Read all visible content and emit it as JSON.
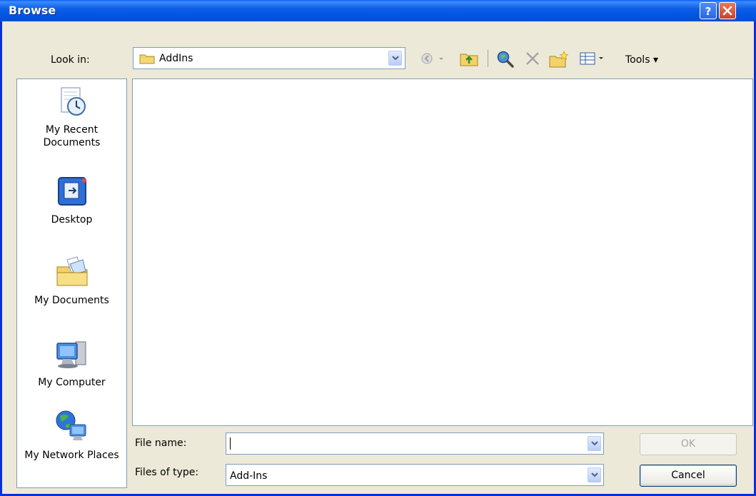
{
  "window": {
    "title": "Browse",
    "help_glyph": "?",
    "close_glyph": "✕"
  },
  "lookin": {
    "label": "Look in:",
    "value": "AddIns"
  },
  "toolbar": {
    "icons": [
      "back-icon",
      "up-folder-icon",
      "search-web-icon",
      "delete-icon",
      "new-folder-icon",
      "views-icon"
    ],
    "tools_label": "Tools ▾"
  },
  "places": [
    {
      "label": "My Recent Documents",
      "icon": "recent-documents-icon"
    },
    {
      "label": "Desktop",
      "icon": "desktop-icon"
    },
    {
      "label": "My Documents",
      "icon": "my-documents-icon"
    },
    {
      "label": "My Computer",
      "icon": "my-computer-icon"
    },
    {
      "label": "My Network Places",
      "icon": "network-places-icon"
    }
  ],
  "file_name": {
    "label": "File name:",
    "value": ""
  },
  "file_type": {
    "label": "Files of type:",
    "value": "Add-Ins"
  },
  "buttons": {
    "ok": "OK",
    "cancel": "Cancel"
  },
  "colors": {
    "titlebar": "#0055E3",
    "dialog_bg": "#ECE9D8",
    "border": "#7F9DB9"
  }
}
